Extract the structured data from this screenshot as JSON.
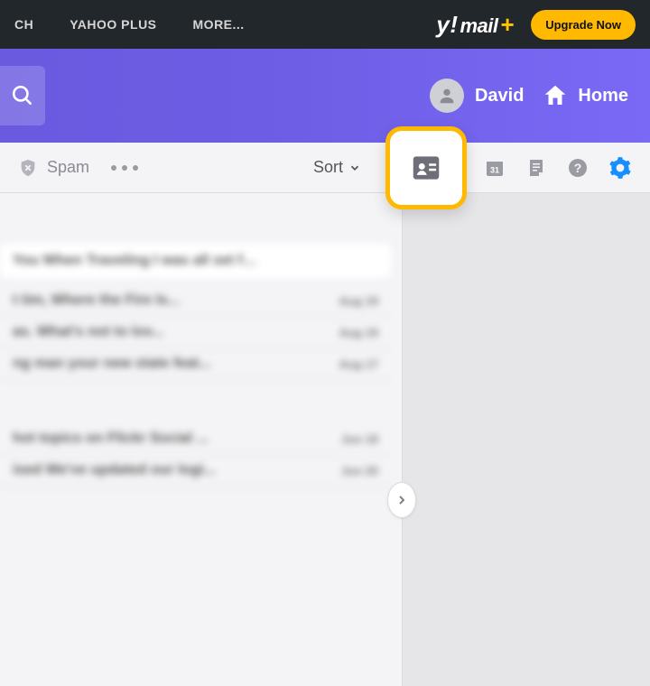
{
  "topbar": {
    "items": [
      "CH",
      "YAHOO PLUS",
      "MORE..."
    ],
    "logo_y": "y!",
    "logo_mail": "mail",
    "logo_plus": "+",
    "upgrade_label": "Upgrade Now"
  },
  "header": {
    "user_name": "David",
    "home_label": "Home"
  },
  "toolbar": {
    "spam_label": "Spam",
    "sort_label": "Sort",
    "calendar_day": "31"
  },
  "icons": {
    "search": "search-icon",
    "avatar": "avatar-icon",
    "home": "home-icon",
    "shield": "shield-x-icon",
    "more": "more-icon",
    "chevron_down": "chevron-down-icon",
    "contacts": "contacts-icon",
    "calendar": "calendar-icon",
    "notepad": "notepad-icon",
    "help": "help-icon",
    "settings": "settings-gear-icon",
    "chevron_right": "chevron-right-icon"
  },
  "messages": [
    {
      "subject": "You When Traveling  I was all set for ...",
      "date": ""
    },
    {
      "subject": "t tim, Where the Fire Is...",
      "date": "Aug 19"
    },
    {
      "subject": "as. What's not to lov...",
      "date": "Aug 19"
    },
    {
      "subject": "ng man  your new state feat...",
      "date": "Aug 17"
    },
    {
      "subject": "hot topics on Flickr Social ...",
      "date": "Jun 18"
    },
    {
      "subject": "ised  We've updated our logi...",
      "date": "Jun 25"
    }
  ]
}
